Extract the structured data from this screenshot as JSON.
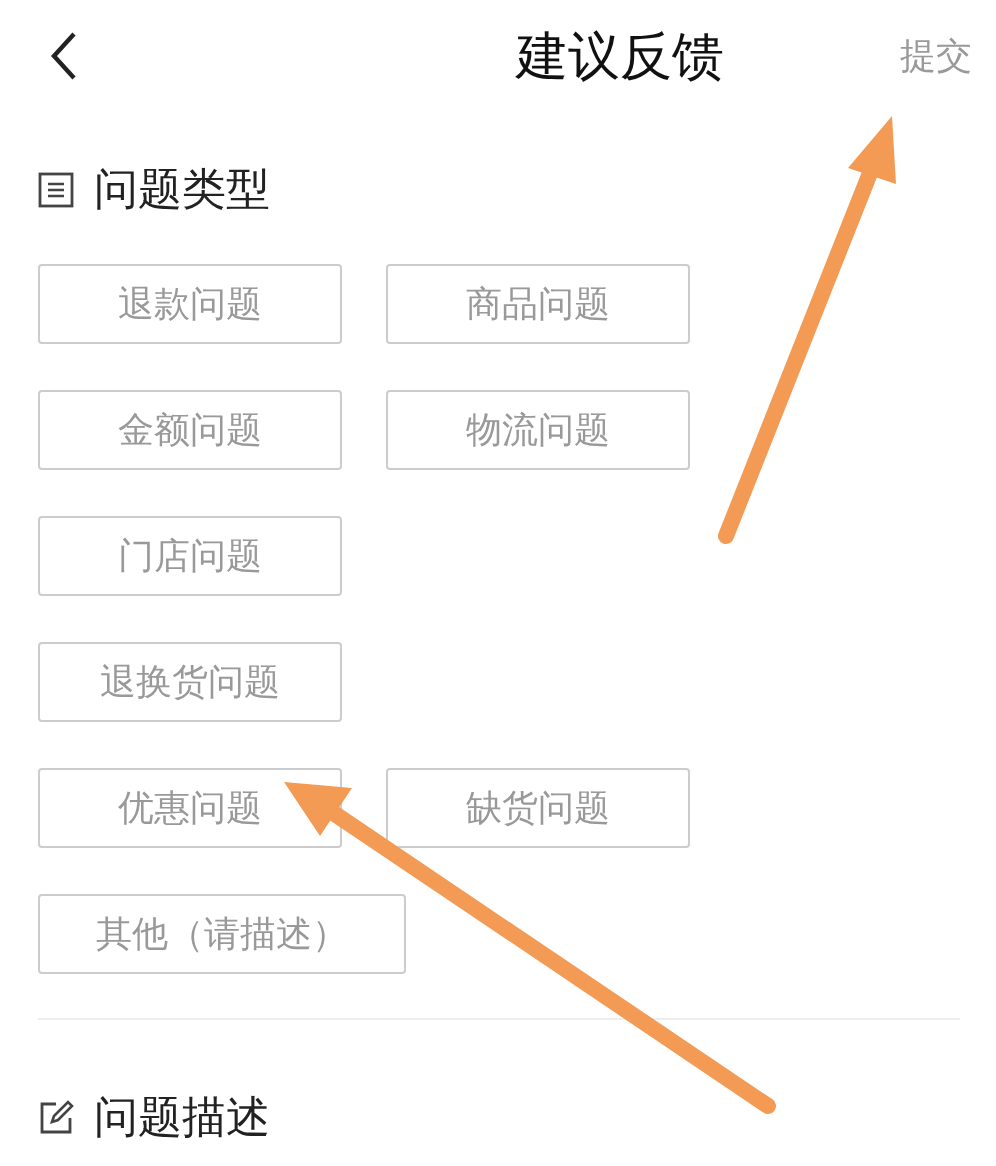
{
  "header": {
    "title": "建议反馈",
    "action": "提交"
  },
  "sections": [
    {
      "title": "问题类型",
      "kind": "list"
    },
    {
      "title": "问题描述",
      "kind": "edit"
    }
  ],
  "option_rows": [
    [
      {
        "label": "退款问题",
        "selected": false
      },
      {
        "label": "商品问题",
        "selected": false
      }
    ],
    [
      {
        "label": "金额问题",
        "selected": false
      },
      {
        "label": "物流问题",
        "selected": false
      }
    ],
    [
      {
        "label": "门店问题",
        "selected": false
      }
    ],
    [
      {
        "label": "退换货问题",
        "selected": false
      }
    ],
    [
      {
        "label": "优惠问题",
        "selected": false
      },
      {
        "label": "缺货问题",
        "selected": false
      }
    ],
    [
      {
        "label": "其他（请描述）",
        "selected": false
      }
    ]
  ]
}
